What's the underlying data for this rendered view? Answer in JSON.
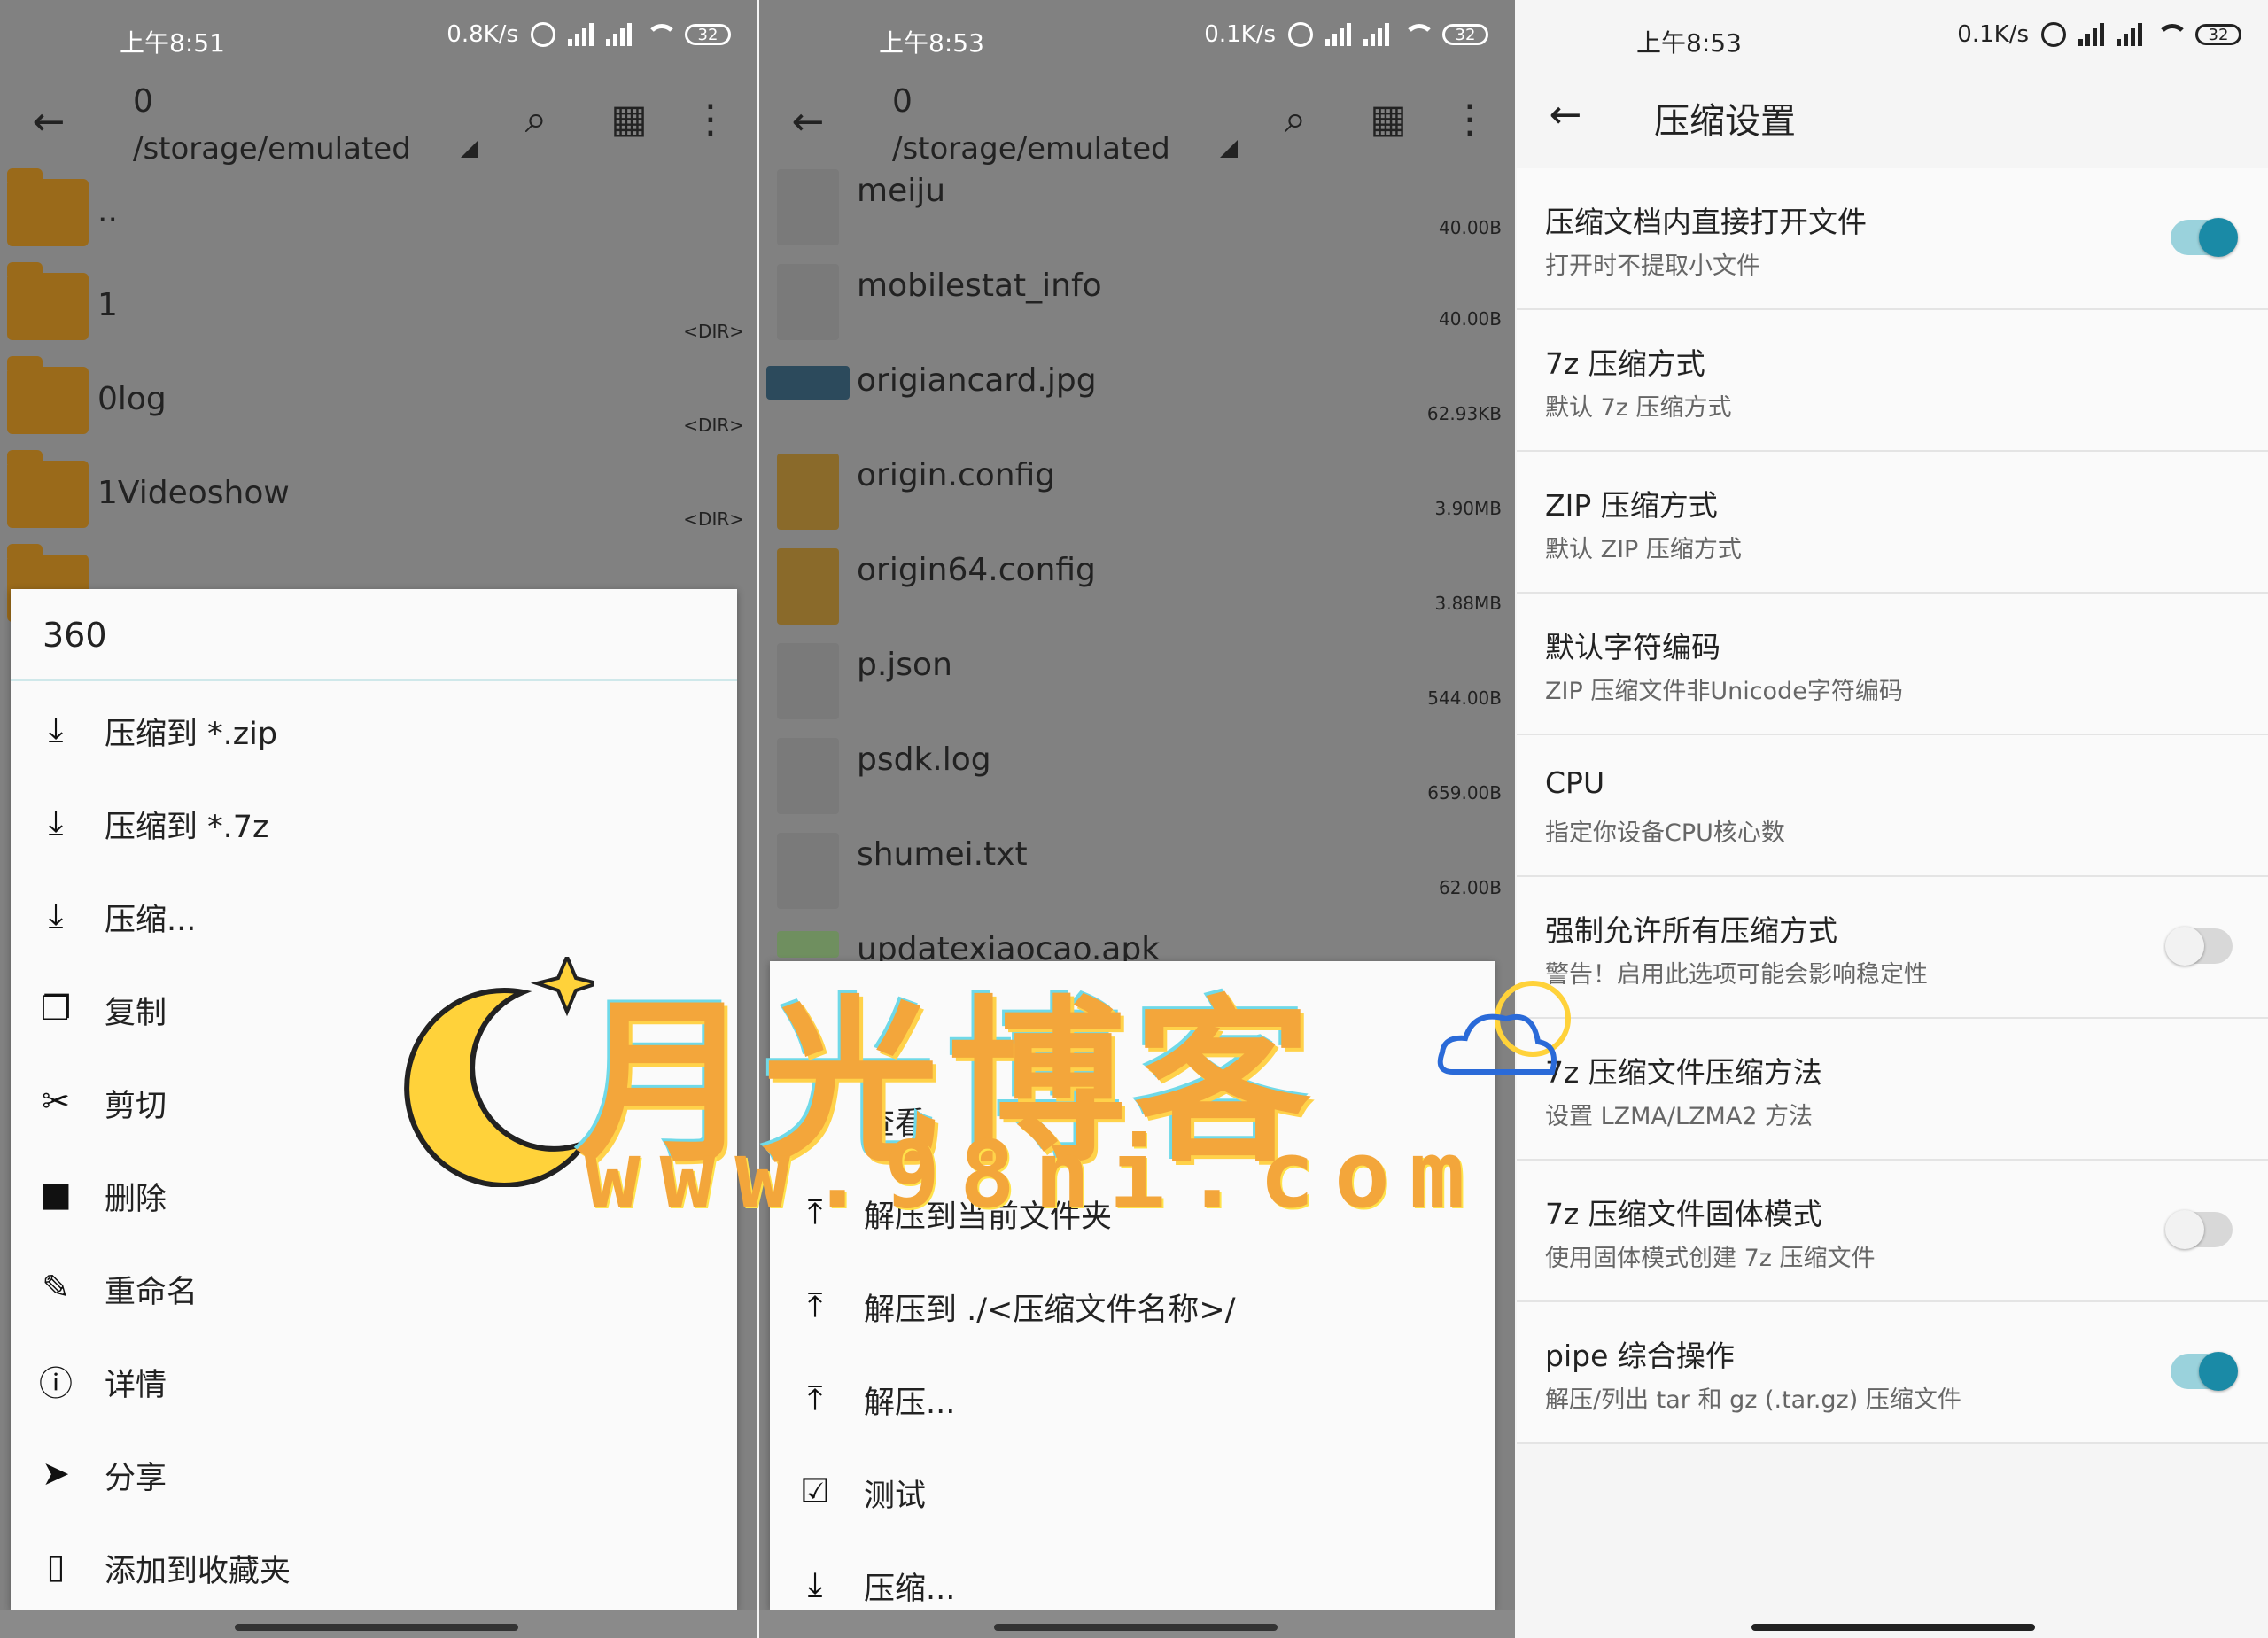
{
  "colors": {
    "accent": "#1a8aa6",
    "folder": "#9a6a1a",
    "watermark": "#f3a63b"
  },
  "panel1": {
    "status": {
      "time": "上午8:51",
      "speed": "0.8K/s",
      "battery": "32"
    },
    "toolbar": {
      "path_num": "0",
      "path": "/storage/emulated"
    },
    "files": [
      {
        "name": "..",
        "size": ""
      },
      {
        "name": "1",
        "size": "<DIR>"
      },
      {
        "name": "0log",
        "size": "<DIR>"
      },
      {
        "name": "1Videoshow",
        "size": "<DIR>"
      }
    ],
    "menu": {
      "title": "360",
      "items": [
        {
          "icon": "download-icon",
          "label": "压缩到 *.zip"
        },
        {
          "icon": "download-icon",
          "label": "压缩到 *.7z"
        },
        {
          "icon": "download-icon",
          "label": "压缩..."
        },
        {
          "icon": "copy-icon",
          "label": "复制"
        },
        {
          "icon": "scissors-icon",
          "label": "剪切"
        },
        {
          "icon": "trash-icon",
          "label": "删除"
        },
        {
          "icon": "pencil-icon",
          "label": "重命名"
        },
        {
          "icon": "info-icon",
          "label": "详情"
        },
        {
          "icon": "send-icon",
          "label": "分享"
        },
        {
          "icon": "bookmark-icon",
          "label": "添加到收藏夹"
        }
      ]
    }
  },
  "panel2": {
    "status": {
      "time": "上午8:53",
      "speed": "0.1K/s",
      "battery": "32"
    },
    "toolbar": {
      "path_num": "0",
      "path": "/storage/emulated"
    },
    "files": [
      {
        "name": "meiju",
        "size": "40.00B",
        "type": "doc"
      },
      {
        "name": "mobilestat_info",
        "size": "40.00B",
        "type": "doc"
      },
      {
        "name": "origiancard.jpg",
        "size": "62.93KB",
        "type": "img"
      },
      {
        "name": "origin.config",
        "size": "3.90MB",
        "type": "cfg"
      },
      {
        "name": "origin64.config",
        "size": "3.88MB",
        "type": "cfg"
      },
      {
        "name": "p.json",
        "size": "544.00B",
        "type": "doc"
      },
      {
        "name": "psdk.log",
        "size": "659.00B",
        "type": "doc"
      },
      {
        "name": "shumei.txt",
        "size": "62.00B",
        "type": "doc"
      },
      {
        "name": "updatexiaocao.apk",
        "size": "",
        "type": "apk"
      }
    ],
    "menu": {
      "items": [
        {
          "icon": "eye-icon",
          "label": "查看"
        },
        {
          "icon": "upload-icon",
          "label": "解压到当前文件夹"
        },
        {
          "icon": "upload-icon",
          "label": "解压到 ./<压缩文件名称>/"
        },
        {
          "icon": "upload-icon",
          "label": "解压..."
        },
        {
          "icon": "checkbox-icon",
          "label": "测试"
        },
        {
          "icon": "download-icon",
          "label": "压缩..."
        }
      ]
    }
  },
  "panel3": {
    "status": {
      "time": "上午8:53",
      "speed": "0.1K/s",
      "battery": "32"
    },
    "title": "压缩设置",
    "settings": [
      {
        "title": "压缩文档内直接打开文件",
        "subtitle": "打开时不提取小文件",
        "toggle": "on"
      },
      {
        "title": "7z 压缩方式",
        "subtitle": "默认 7z 压缩方式",
        "toggle": ""
      },
      {
        "title": "ZIP 压缩方式",
        "subtitle": "默认 ZIP 压缩方式",
        "toggle": ""
      },
      {
        "title": "默认字符编码",
        "subtitle": "ZIP 压缩文件非Unicode字符编码",
        "toggle": ""
      },
      {
        "title": "CPU",
        "subtitle": "指定你设备CPU核心数",
        "toggle": ""
      },
      {
        "title": "强制允许所有压缩方式",
        "subtitle": "警告！启用此选项可能会影响稳定性",
        "toggle": "off"
      },
      {
        "title": "7z 压缩文件压缩方法",
        "subtitle": "设置 LZMA/LZMA2 方法",
        "toggle": ""
      },
      {
        "title": "7z 压缩文件固体模式",
        "subtitle": "使用固体模式创建 7z 压缩文件",
        "toggle": "off"
      },
      {
        "title": "pipe 综合操作",
        "subtitle": "解压/列出 tar 和 gz (.tar.gz) 压缩文件",
        "toggle": "on"
      }
    ]
  },
  "watermark": {
    "title": "月光博客",
    "url": "www.98ni.com"
  }
}
